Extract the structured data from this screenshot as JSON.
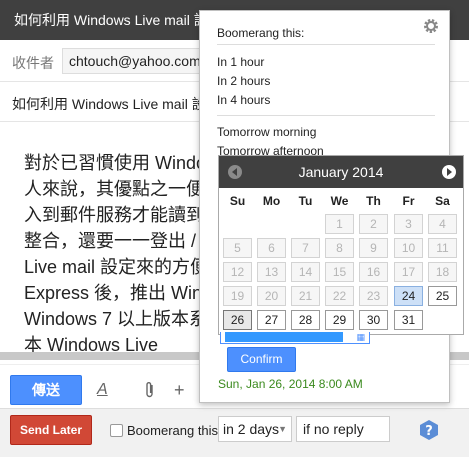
{
  "compose": {
    "title": "如何利用 Windows Live mail 設",
    "to_label": "收件者",
    "to_value": "chtouch@yahoo.com",
    "subject": "如何利用 Windows Live mail 設",
    "body_lines": [
      "對於已習慣使用 Windows Live",
      "人來說，其優點之一便是",
      "入到郵件服務才能讀到",
      "整合，還要一一登出 / 登入",
      "Live mail 設定來的方便",
      "Express 後，推出 Windows",
      "Windows 7 以上版本系統",
      "本 Windows Live"
    ],
    "send_label": "傳送"
  },
  "bottom_bar": {
    "send_later_label": "Send Later",
    "boomerang_label": "Boomerang this",
    "days_select": "in 2 days",
    "reply_select": "if no reply",
    "help_icon": "help-icon"
  },
  "popup": {
    "heading": "Boomerang this:",
    "options": [
      "In 1 hour",
      "In 2 hours",
      "In 4 hours"
    ],
    "options2": [
      "Tomorrow morning",
      "Tomorrow afternoon"
    ],
    "calendar": {
      "month_title": "January 2014",
      "weekdays": [
        "Su",
        "Mo",
        "Tu",
        "We",
        "Th",
        "Fr",
        "Sa"
      ],
      "weeks": [
        [
          "",
          "",
          "",
          "1",
          "2",
          "3",
          "4"
        ],
        [
          "5",
          "6",
          "7",
          "8",
          "9",
          "10",
          "11"
        ],
        [
          "12",
          "13",
          "14",
          "15",
          "16",
          "17",
          "18"
        ],
        [
          "19",
          "20",
          "21",
          "22",
          "23",
          "24",
          "25"
        ],
        [
          "26",
          "27",
          "28",
          "29",
          "30",
          "31",
          ""
        ]
      ],
      "today": "24",
      "selected": "26",
      "first_available": "24"
    },
    "confirm_label": "Confirm",
    "scheduled_text": "Sun, Jan 26, 2014 8:00 AM"
  },
  "colors": {
    "titlebar": "#404040",
    "send_blue": "#4d90fe",
    "send_later_red": "#d14836",
    "confirm_green_text": "#3b8a1e"
  }
}
